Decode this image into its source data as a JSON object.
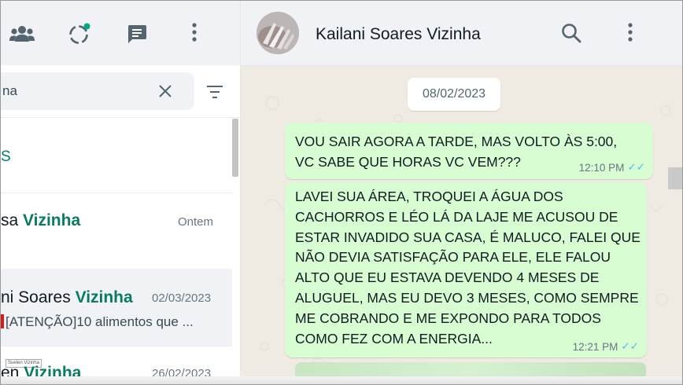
{
  "left_header": {
    "icons": [
      "community-icon",
      "status-icon",
      "new-chat-icon",
      "menu-icon"
    ]
  },
  "search": {
    "value": "na"
  },
  "section_label": "S",
  "chats": [
    {
      "name_prefix": "sa ",
      "name_highlight": "Vizinha",
      "date": "Ontem",
      "preview": ""
    },
    {
      "name_prefix": "ni Soares ",
      "name_highlight": "Vizinha",
      "date": "02/03/2023",
      "preview": "[ATENÇÃO]10 alimentos que ..."
    },
    {
      "tag": "Suelen Vizinha",
      "name_prefix": "en ",
      "name_highlight": "Vizinha",
      "date": "26/02/2023",
      "preview": ""
    }
  ],
  "conversation": {
    "contact_name": "Kailani Soares Vizinha",
    "date_chip": "08/02/2023",
    "messages": [
      {
        "lines": [
          "VOU SAIR AGORA A TARDE, MAS VOLTO ÀS 5:00,",
          "VC SABE QUE HORAS VC VEM???"
        ],
        "time": "12:10 PM",
        "ticks": "✓✓"
      },
      {
        "lines": [
          "LAVEI SUA ÁREA, TROQUEI A ÁGUA DOS",
          "CACHORROS E  LÉO LÁ DA LAJE ME ACUSOU DE",
          "ESTAR INVADIDO SUA CASA, É MALUCO, FALEI QUE",
          "NÃO DEVIA SATISFAÇÃO PARA ELE, ELE FALOU",
          "ALTO QUE EU ESTAVA DEVENDO 4 MESES DE",
          "ALUGUEL, MAS EU DEVO 3 MESES, COMO SEMPRE",
          "ME COBRANDO E ME EXPONDO PARA TODOS",
          "COMO FEZ COM A ENERGIA..."
        ],
        "time": "12:21 PM",
        "ticks": "✓✓"
      }
    ]
  },
  "colors": {
    "accent": "#008069",
    "bubble": "#d9fdd3",
    "header": "#f0f2f5",
    "chat_bg": "#efeae2",
    "read_ticks": "#53bdeb"
  }
}
